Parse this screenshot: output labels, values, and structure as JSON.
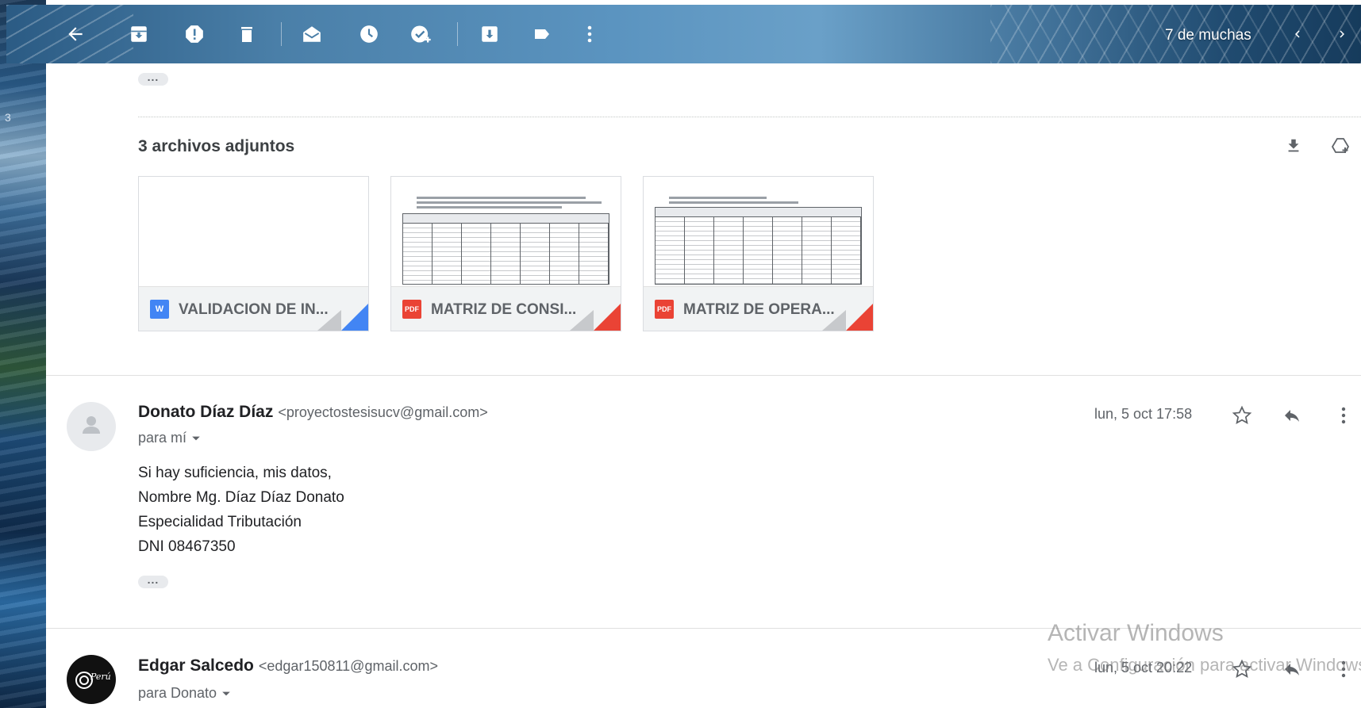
{
  "toolbar": {
    "icons": [
      "back-arrow-icon",
      "archive-icon",
      "report-spam-icon",
      "delete-icon",
      "mark-unread-icon",
      "snooze-icon",
      "add-to-tasks-icon",
      "move-to-icon",
      "label-icon",
      "more-vert-icon"
    ],
    "counter": "7 de muchas"
  },
  "background": {
    "edge_number": "3"
  },
  "attachments": {
    "title": "3 archivos adjuntos",
    "items": [
      {
        "name": "VALIDACION DE IN...",
        "type_badge": "W",
        "color": "#4285f4"
      },
      {
        "name": "MATRIZ DE CONSI...",
        "type_badge": "PDF",
        "color": "#ea4335"
      },
      {
        "name": "MATRIZ DE OPERA...",
        "type_badge": "PDF",
        "color": "#ea4335"
      }
    ]
  },
  "messages": [
    {
      "sender": "Donato Díaz Díaz",
      "email": "<proyectostesisucv@gmail.com>",
      "to": "para mí",
      "date": "lun, 5 oct 17:58",
      "body": [
        "Si hay suficiencia, mis datos,",
        "Nombre Mg. Díaz Díaz Donato",
        "Especialidad Tributación",
        "DNI 08467350"
      ]
    },
    {
      "sender": "Edgar Salcedo",
      "email": "<edgar150811@gmail.com>",
      "to": "para Donato",
      "date": "lun, 5 oct 20:22",
      "avatar_text": "Perú"
    }
  ],
  "watermark": {
    "line1": "Activar Windows",
    "line2": "Ve a Configuración para activar Windows."
  },
  "colors": {
    "accent_blue": "#4285f4",
    "pdf_red": "#ea4335"
  }
}
